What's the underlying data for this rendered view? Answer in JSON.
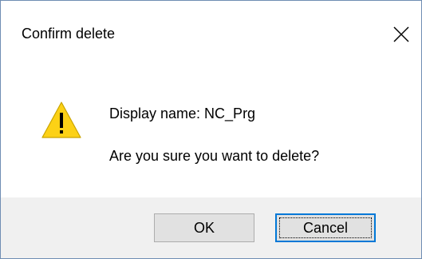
{
  "dialog": {
    "title": "Confirm delete",
    "close_icon": "close-icon",
    "icon": "warning-icon",
    "message_line1": "Display name: NC_Prg",
    "message_line2": "Are you sure you want to delete?",
    "buttons": {
      "ok_label": "OK",
      "cancel_label": "Cancel"
    },
    "focused_button": "Cancel"
  },
  "colors": {
    "border": "#6f8db3",
    "footer_bg": "#f0f0f0",
    "button_bg": "#e1e1e1",
    "focus_accent": "#0078d7",
    "warning_yellow": "#fcd116"
  }
}
